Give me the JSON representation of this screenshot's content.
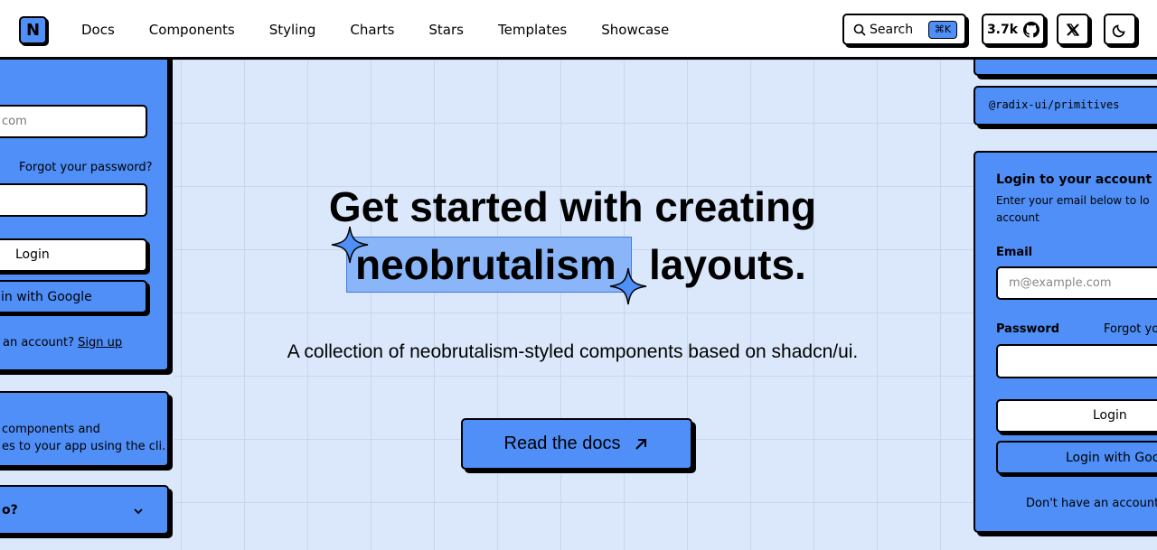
{
  "header": {
    "logo_letter": "N",
    "nav": [
      "Docs",
      "Components",
      "Styling",
      "Charts",
      "Stars",
      "Templates",
      "Showcase"
    ],
    "search_label": "Search",
    "search_kbd": "⌘K",
    "github_stars": "3.7k"
  },
  "hero": {
    "title_line1": "Get started with creating",
    "title_highlight": "neobrutalism",
    "title_rest": "layouts.",
    "subtitle": "A collection of neobrutalism-styled components based on shadcn/ui.",
    "cta_label": "Read the docs"
  },
  "left_panel": {
    "email_placeholder": "com",
    "forgot_password": "Forgot your password?",
    "login_label": "Login",
    "google_label": "in with Google",
    "no_account": "an account?",
    "signup": "Sign up",
    "install_text_1": "components and",
    "install_text_2": "es to your app using the cli.",
    "accordion_label": "o?"
  },
  "right_panel": {
    "package": "@radix-ui/primitives",
    "login_title": "Login to your account",
    "login_desc_1": "Enter your email below to lo",
    "login_desc_2": "account",
    "email_label": "Email",
    "email_placeholder": "m@example.com",
    "password_label": "Password",
    "forgot_label": "Forgot yo",
    "login_label": "Login",
    "google_label": "Login with Goog",
    "no_account": "Don't have an account?"
  },
  "colors": {
    "accent": "#4f8ff7",
    "highlight": "#8ab6f9",
    "background": "#dbe8fb"
  }
}
